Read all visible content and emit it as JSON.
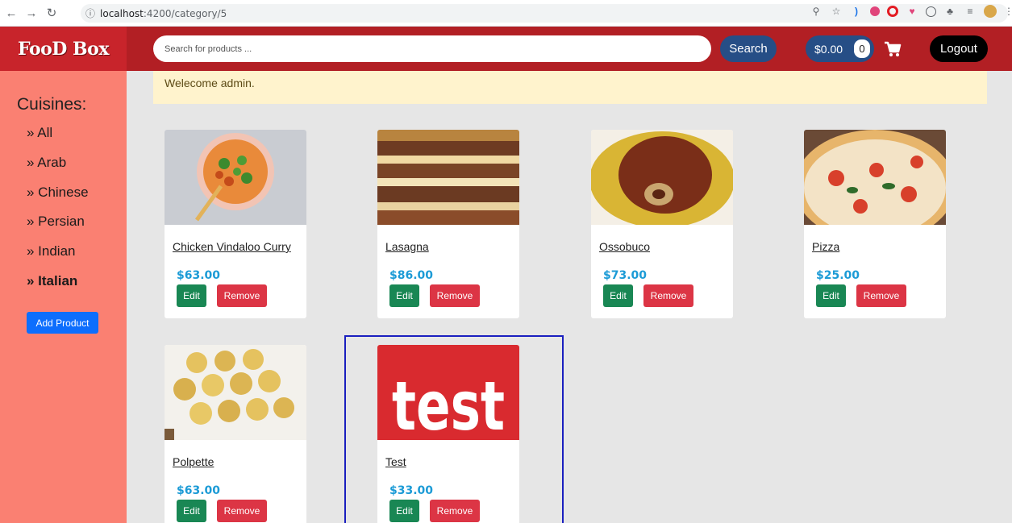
{
  "browser": {
    "url_host": "localhost",
    "url_path": ":4200/category/5"
  },
  "navbar": {
    "brand": "FooD Box",
    "search_placeholder": "Search for products ...",
    "search_label": "Search",
    "cart_total": "$0.00",
    "cart_count": "0",
    "logout_label": "Logout"
  },
  "sidebar": {
    "title": "Cuisines:",
    "items": [
      {
        "label": "» All"
      },
      {
        "label": "» Arab"
      },
      {
        "label": "» Chinese"
      },
      {
        "label": "» Persian"
      },
      {
        "label": "» Indian"
      },
      {
        "label": "» Italian",
        "active": true
      }
    ],
    "add_product_label": "Add Product"
  },
  "welcome": "Welecome admin.",
  "products": [
    {
      "name": "Chicken Vindaloo Curry",
      "price": "$63.00",
      "image": "curry-bowl"
    },
    {
      "name": "Lasagna",
      "price": "$86.00",
      "image": "lasagna"
    },
    {
      "name": "Ossobuco",
      "price": "$73.00",
      "image": "ossobuco"
    },
    {
      "name": "Pizza",
      "price": "$25.00",
      "image": "pizza"
    },
    {
      "name": "Polpette",
      "price": "$63.00",
      "image": "polpette"
    },
    {
      "name": "Test",
      "price": "$33.00",
      "image": "test-logo",
      "image_text": "test"
    }
  ],
  "card_actions": {
    "edit_label": "Edit",
    "remove_label": "Remove"
  },
  "colors": {
    "navbar": "#b21f24",
    "sidebar": "#fa8072",
    "pill": "#264e86",
    "price": "#1c9bd6",
    "edit": "#198754",
    "remove": "#dc3545",
    "add_product": "#0d6efd",
    "highlight": "#1a1fbf"
  }
}
